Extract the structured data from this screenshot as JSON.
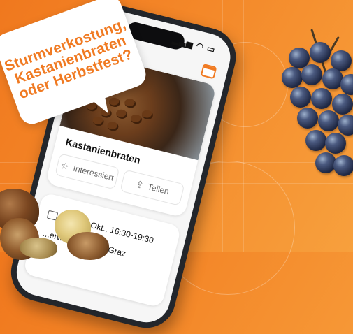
{
  "promo": {
    "bubble_text": "Sturmverkostung,\nKastanienbraten\noder Herbstfest?"
  },
  "phone": {
    "status_icons": "signal-wifi-battery-icons",
    "header_icon": "calendar-icon"
  },
  "event": {
    "title": "Kastanienbraten",
    "interested_label": "Interessiert",
    "share_label": "Teilen",
    "date_time": "Sa. 12. Okt., 16:30-19:30",
    "address_partial": "...erweg 25, 8046 Graz"
  },
  "colors": {
    "brand_orange": "#f07a22",
    "background_light_orange": "#f7a03d"
  }
}
